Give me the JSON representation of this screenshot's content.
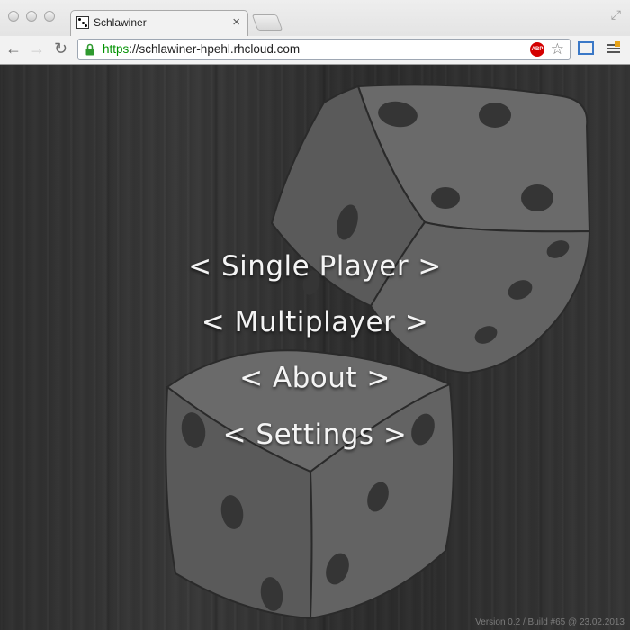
{
  "browser": {
    "tab_title": "Schlawiner",
    "url_scheme": "https",
    "url_rest": "://schlawiner-hpehl.rhcloud.com",
    "adblock_label": "ABP",
    "tab_close_glyph": "×",
    "back_glyph": "←",
    "forward_glyph": "→",
    "reload_glyph": "↻",
    "star_glyph": "☆",
    "resize_glyph": "⤢"
  },
  "menu": {
    "single_player": "< Single Player >",
    "multiplayer": "< Multiplayer >",
    "about": "< About >",
    "settings": "< Settings >"
  },
  "footer": {
    "version": "Version 0.2 / Build #65 @ 23.02.2013"
  },
  "colors": {
    "text": "#f4f4f4",
    "dice_face": "#5e5e5e",
    "pip": "#333333",
    "secure_url": "#009200"
  }
}
